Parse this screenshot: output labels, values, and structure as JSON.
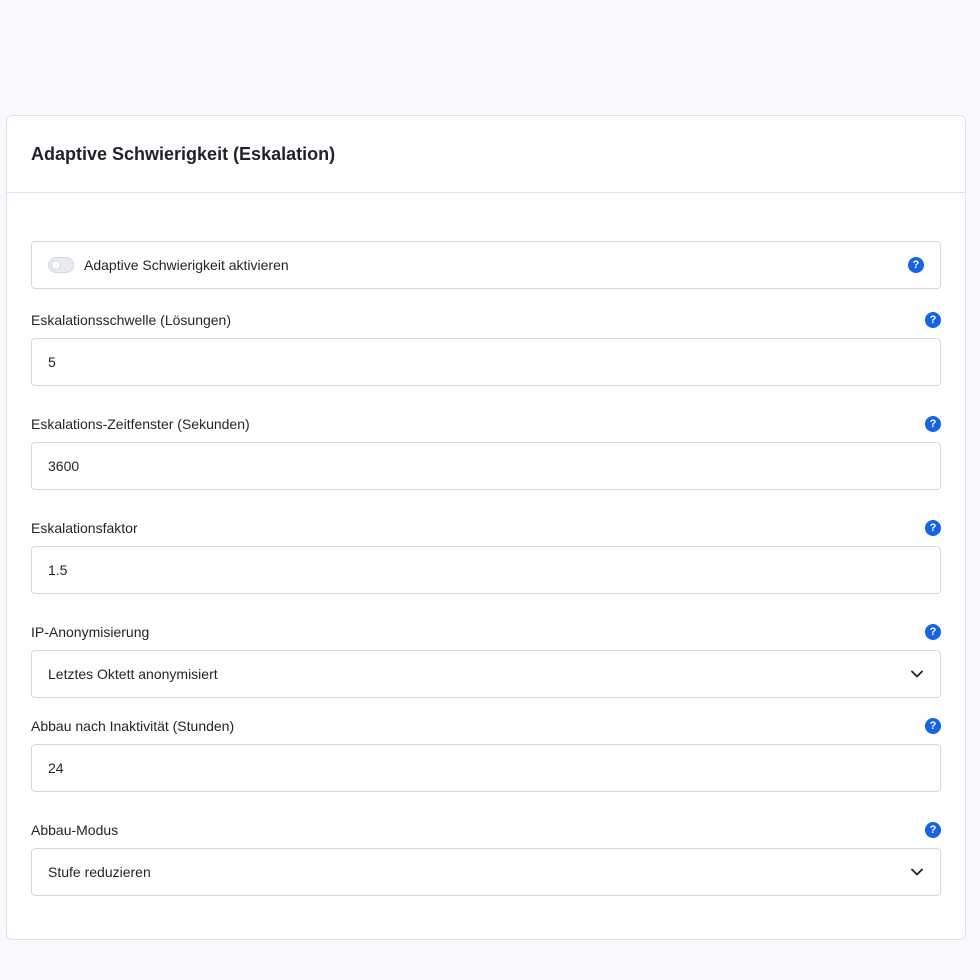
{
  "card": {
    "title": "Adaptive Schwierigkeit (Eskalation)"
  },
  "toggle": {
    "label": "Adaptive Schwierigkeit aktivieren",
    "enabled": false
  },
  "help_glyph": "?",
  "fields": [
    {
      "label": "Eskalationsschwelle (Lösungen)",
      "value": "5",
      "kind": "input"
    },
    {
      "label": "Eskalations-Zeitfenster (Sekunden)",
      "value": "3600",
      "kind": "input"
    },
    {
      "label": "Eskalationsfaktor",
      "value": "1.5",
      "kind": "input"
    },
    {
      "label": "IP-Anonymisierung",
      "value": "Letztes Oktett anonymisiert",
      "kind": "select"
    },
    {
      "label": "Abbau nach Inaktivität (Stunden)",
      "value": "24",
      "kind": "input"
    },
    {
      "label": "Abbau-Modus",
      "value": "Stufe reduzieren",
      "kind": "select"
    }
  ],
  "colors": {
    "accent": "#1763e6",
    "border": "#d4d7dd",
    "background": "#f8f9fc"
  },
  "icons": {
    "help": "question-circle-icon",
    "dropdown": "chevron-down-icon",
    "toggle": "switch"
  }
}
